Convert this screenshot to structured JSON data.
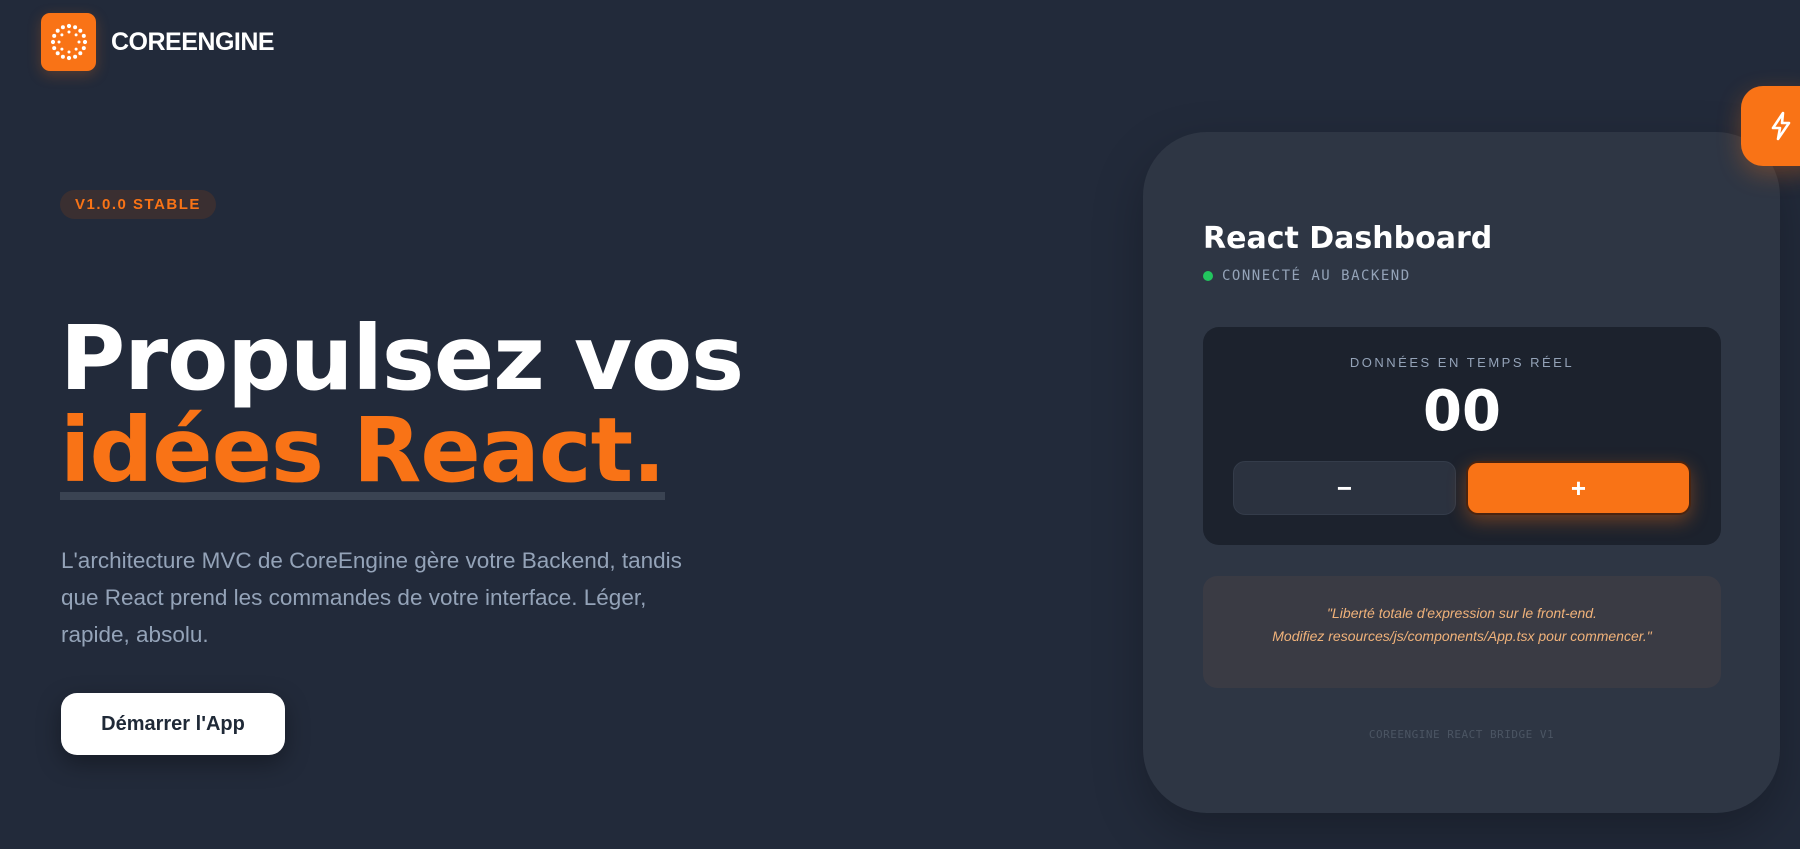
{
  "brand": {
    "name": "COREENGINE",
    "logo_icon": "sunburst-dots-icon",
    "accent": "#f97316"
  },
  "hero": {
    "badge": "V1.0.0 STABLE",
    "headline_line1": "Propulsez vos",
    "headline_line2": "idées React.",
    "description": "L'architecture MVC de CoreEngine gère votre Backend, tandis que React prend les commandes de votre interface. Léger, rapide, absolu.",
    "cta_label": "Démarrer l'App"
  },
  "dashboard": {
    "title": "React Dashboard",
    "status_text": "CONNECTÉ AU BACKEND",
    "status_color": "#22c55e",
    "panel_label": "DONNÉES EN TEMPS RÉEL",
    "counter_value": "00",
    "minus_label": "−",
    "plus_label": "+",
    "quote_line1": "\"Liberté totale d'expression sur le front-end.",
    "quote_line2": "Modifiez resources/js/components/App.tsx pour commencer.\"",
    "footer": "COREENGINE REACT BRIDGE V1"
  },
  "floating_button": {
    "icon": "lightning-bolt-icon"
  }
}
